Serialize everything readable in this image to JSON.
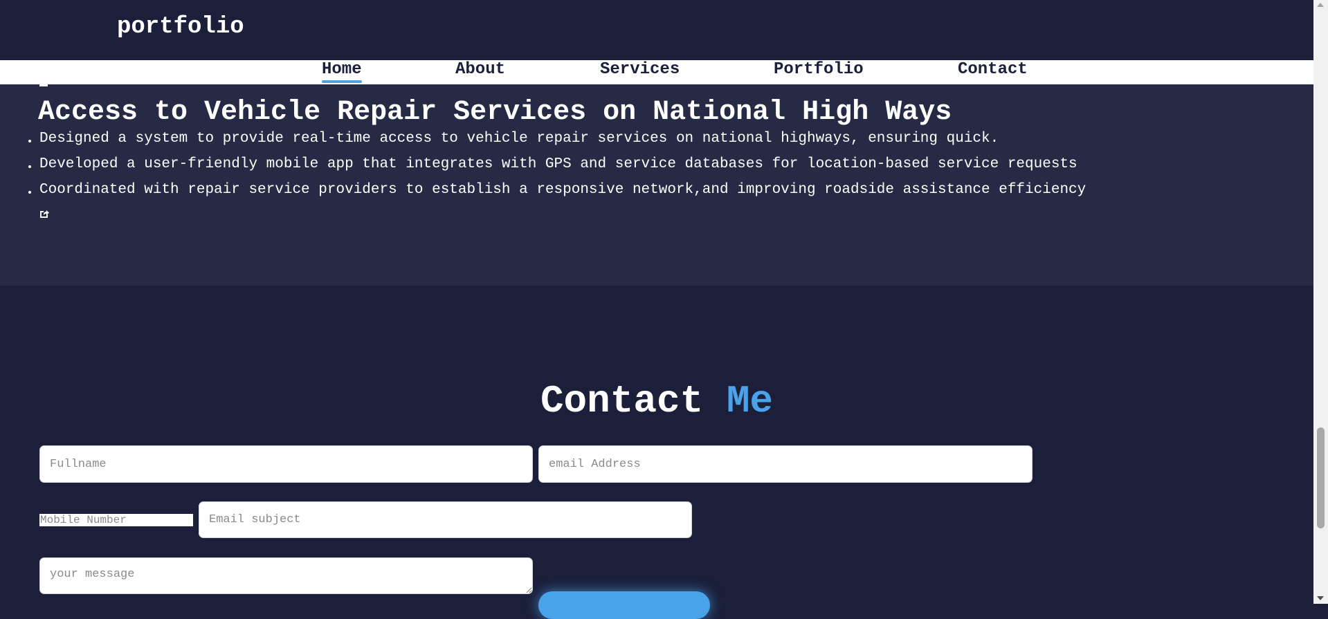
{
  "header": {
    "logo": "portfolio"
  },
  "nav": {
    "items": [
      {
        "label": "Home",
        "active": true
      },
      {
        "label": "About",
        "active": false
      },
      {
        "label": "Services",
        "active": false
      },
      {
        "label": "Portfolio",
        "active": false
      },
      {
        "label": "Contact",
        "active": false
      }
    ]
  },
  "project": {
    "title": "Access to Vehicle Repair Services on National High Ways",
    "bullets": [
      "Designed a system to provide real-time access to vehicle repair services on national highways, ensuring quick.",
      "Developed a user-friendly mobile app that integrates with GPS and service databases for location-based service requests",
      "Coordinated with repair service providers to establish a responsive network,and improving roadside assistance efficiency"
    ],
    "link_icon": "external-link-icon"
  },
  "contact": {
    "title_main": "Contact",
    "title_accent": "Me",
    "fields": {
      "fullname_placeholder": "Fullname",
      "email_placeholder": "email Address",
      "mobile_placeholder": "Mobile Number",
      "subject_placeholder": "Email subject",
      "message_placeholder": "your message"
    }
  },
  "colors": {
    "page_bg": "#1b1f3a",
    "section_bg": "#262a45",
    "accent": "#4aa3e8",
    "nav_bg": "#ffffff"
  }
}
